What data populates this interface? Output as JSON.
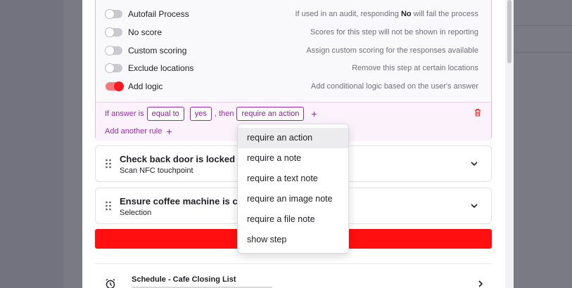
{
  "options": [
    {
      "label": "Autofail Process",
      "desc_before": "If used in an audit, responding ",
      "desc_bold": "No",
      "desc_after": " will fail the process",
      "on": false
    },
    {
      "label": "No score",
      "desc": "Scores for this step will not be shown in reporting",
      "on": false
    },
    {
      "label": "Custom scoring",
      "desc": "Assign custom scoring for the responses available",
      "on": false
    },
    {
      "label": "Exclude locations",
      "desc": "Remove this step at certain locations",
      "on": false
    },
    {
      "label": "Add logic",
      "desc": "Add conditional logic based on the user's answer",
      "on": true
    }
  ],
  "logic": {
    "if_answer_is": "If answer is",
    "operator": "equal to",
    "value": "yes",
    "then": ", then",
    "action": "require an action",
    "add_rule": "Add another rule",
    "plus": "+"
  },
  "steps": [
    {
      "title": "Check back door is locked",
      "subtitle": "Scan NFC touchpoint"
    },
    {
      "title": "Ensure coffee machine is cle",
      "subtitle": "Selection"
    }
  ],
  "dropdown": {
    "items": [
      "require an action",
      "require a note",
      "require a text note",
      "require an image note",
      "require a file note",
      "show step"
    ],
    "selected_index": 0
  },
  "schedule": {
    "title": "Schedule - Cafe Closing List"
  },
  "colors": {
    "accent_purple": "#9b2ba7",
    "toggle_on": "#f81c22",
    "danger_bar": "#ff0f0f"
  }
}
